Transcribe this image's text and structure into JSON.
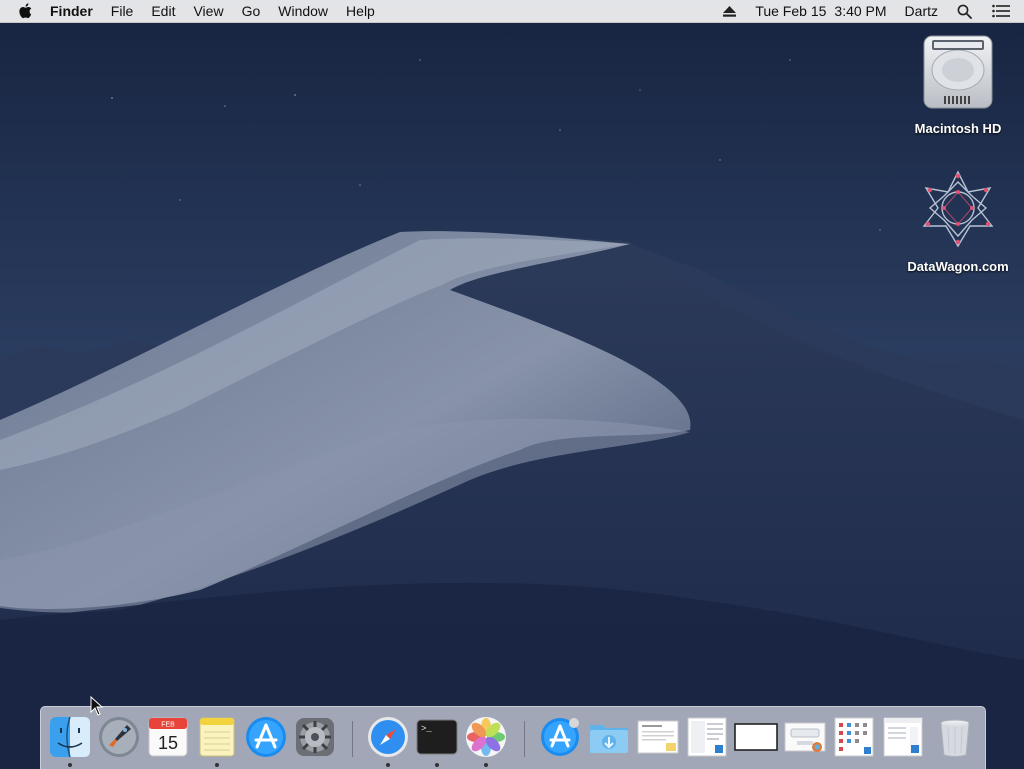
{
  "menubar": {
    "app_name": "Finder",
    "menus": [
      "File",
      "Edit",
      "View",
      "Go",
      "Window",
      "Help"
    ],
    "status": {
      "eject_icon": "eject-icon",
      "date": "Tue Feb 15",
      "time": "3:40 PM",
      "user": "Dartz",
      "spotlight_icon": "search-icon",
      "notification_icon": "list-icon"
    }
  },
  "desktop": {
    "icons": [
      {
        "label": "Macintosh HD",
        "icon": "hard-drive-icon"
      },
      {
        "label": "DataWagon.com",
        "icon": "datawagon-logo-icon"
      }
    ]
  },
  "dock": {
    "apps": [
      {
        "name": "Finder",
        "icon": "finder-icon",
        "running": true
      },
      {
        "name": "Launchpad",
        "icon": "launchpad-icon",
        "running": false
      },
      {
        "name": "Calendar",
        "icon": "calendar-icon",
        "running": false,
        "month": "FEB",
        "day": "15"
      },
      {
        "name": "Notes",
        "icon": "notes-icon",
        "running": true
      },
      {
        "name": "App Store",
        "icon": "app-store-icon",
        "running": false
      },
      {
        "name": "System Preferences",
        "icon": "gear-icon",
        "running": false
      },
      {
        "name": "Safari",
        "icon": "safari-icon",
        "running": true
      },
      {
        "name": "Terminal",
        "icon": "terminal-icon",
        "running": true,
        "prompt": ">_"
      },
      {
        "name": "Photos",
        "icon": "photos-icon",
        "running": true
      }
    ],
    "others": [
      {
        "name": "App Store installer",
        "icon": "app-store-icon"
      },
      {
        "name": "Downloads",
        "icon": "downloads-folder-icon"
      },
      {
        "name": "Document 1",
        "icon": "document-thumbnail-icon"
      },
      {
        "name": "Document 2",
        "icon": "document-thumbnail-icon"
      },
      {
        "name": "Window 1",
        "icon": "window-thumbnail-icon"
      },
      {
        "name": "Document 3",
        "icon": "document-thumbnail-icon"
      },
      {
        "name": "Document 4",
        "icon": "document-thumbnail-icon"
      },
      {
        "name": "Document 5",
        "icon": "document-thumbnail-icon"
      },
      {
        "name": "Trash",
        "icon": "trash-icon"
      }
    ]
  },
  "colors": {
    "menubar_bg": "#ececee",
    "sky_top": "#1a2845",
    "sky_bottom": "#2a3a5c",
    "accent_blue": "#1a7cf0"
  }
}
